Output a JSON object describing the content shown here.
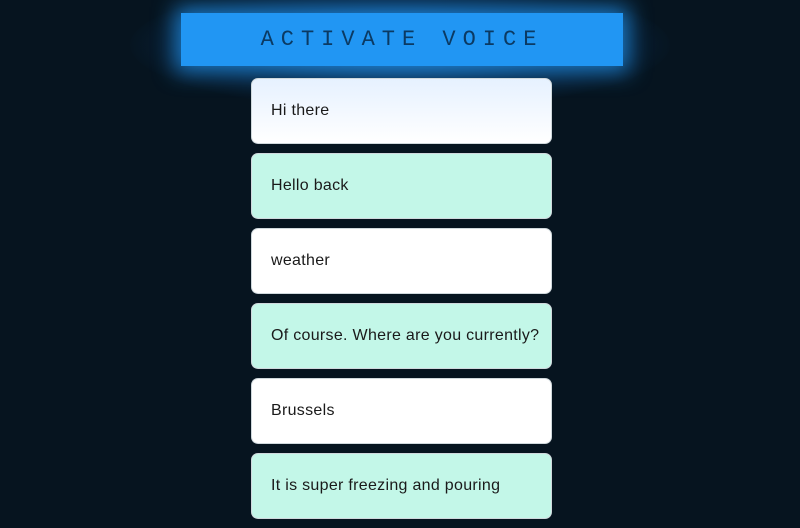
{
  "header": {
    "button_label": "ACTIVATE VOICE"
  },
  "messages": [
    {
      "role": "user",
      "text": "Hi there"
    },
    {
      "role": "bot",
      "text": "Hello back"
    },
    {
      "role": "user",
      "text": "weather"
    },
    {
      "role": "bot",
      "text": "Of course. Where are you currently?"
    },
    {
      "role": "user",
      "text": "Brussels"
    },
    {
      "role": "bot",
      "text": "It is super freezing and pouring"
    }
  ],
  "colors": {
    "background": "#06141f",
    "button": "#2196f3",
    "bot_bubble": "#c3f7e8",
    "user_bubble": "#ffffff"
  }
}
